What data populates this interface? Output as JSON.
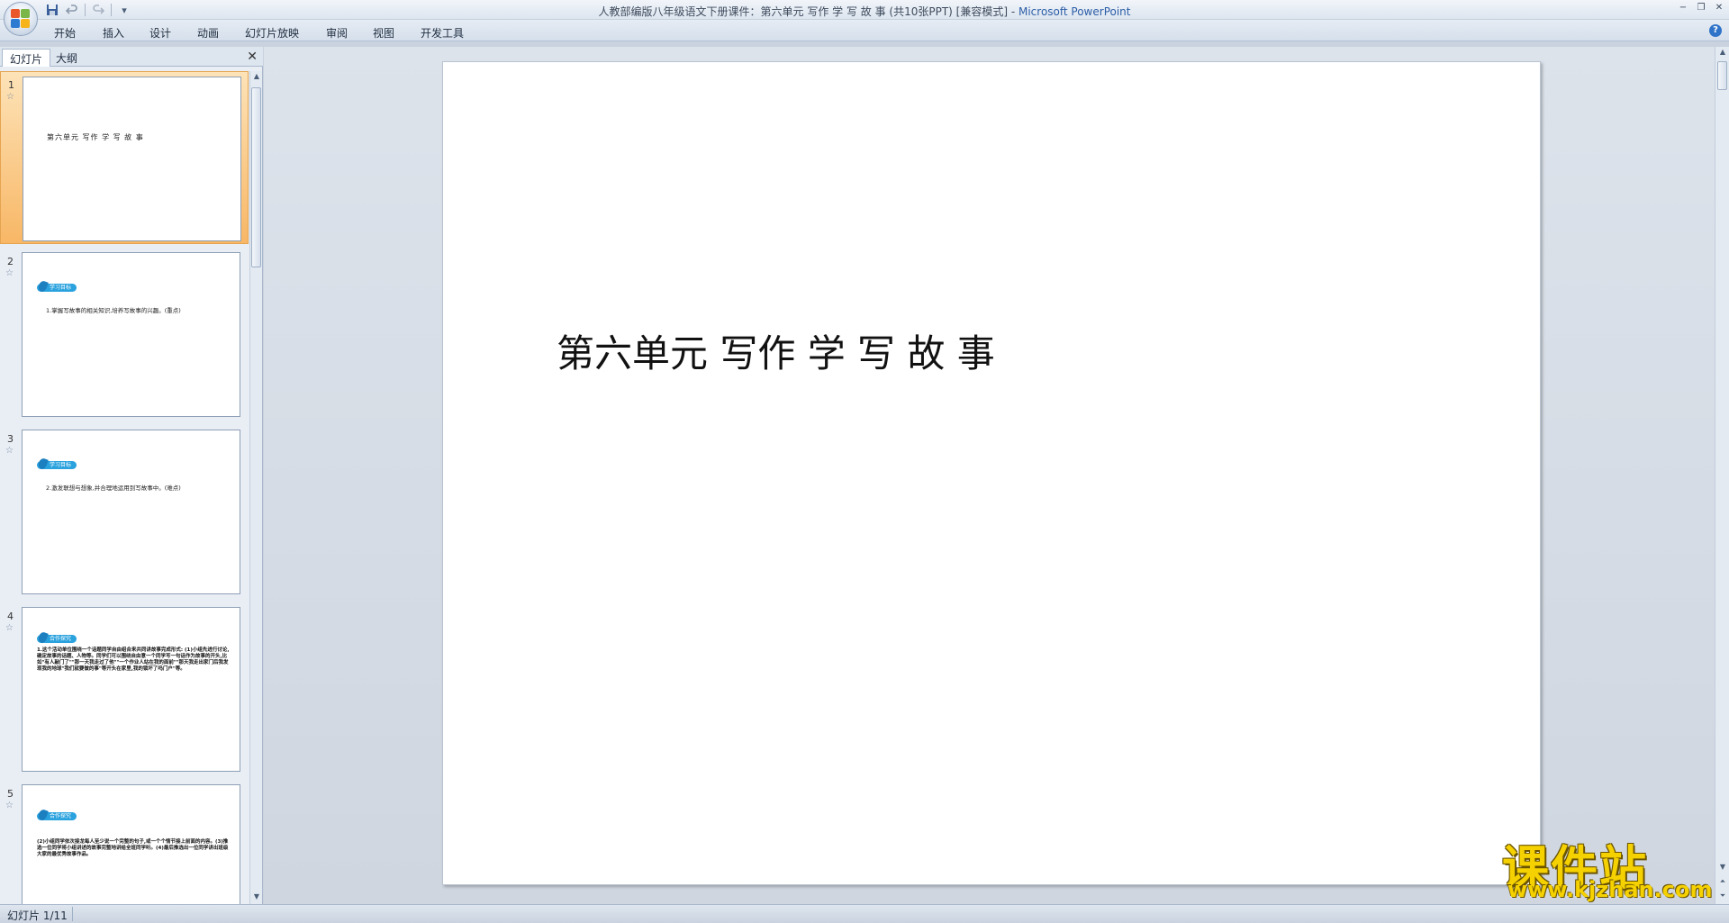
{
  "window": {
    "title_doc": "人教部编版八年级语文下册课件：第六单元 写作 学 写 故 事 (共10张PPT) [兼容模式] - ",
    "title_app": "Microsoft PowerPoint",
    "minimize": "−",
    "restore": "❐",
    "close": "✕"
  },
  "qat": {
    "save_icon": "save-icon",
    "undo_icon": "undo-icon",
    "redo_icon": "redo-icon",
    "customize": "▾"
  },
  "ribbon": {
    "tabs": [
      "开始",
      "插入",
      "设计",
      "动画",
      "幻灯片放映",
      "审阅",
      "视图",
      "开发工具"
    ],
    "help": "?"
  },
  "left_pane": {
    "tabs": [
      "幻灯片",
      "大纲"
    ],
    "close": "✕",
    "thumbnails": [
      {
        "number": "1",
        "title": "第六单元 写作 学 写 故 事"
      },
      {
        "number": "2",
        "badge": "学习目标",
        "text": "1.掌握写故事的相关知识,培养写故事的兴趣。(重点)"
      },
      {
        "number": "3",
        "badge": "学习目标",
        "text": "2.激发联想与想象,并合理地运用到写故事中。(难点)"
      },
      {
        "number": "4",
        "badge": "合作探究",
        "text": "1.这个活动单位围绕一个话题同学自由组合来共同讲故事完成形式: (1)小组先进行讨论,确定故事的话题、人物等。同学们可以围绕自由意一个同学写一句话作为故事的开头,比如\"有人敲门了\"\"那一天我走过了他\"\"一个作业人站在我的面前\"\"那天我走出家门后我发现我的地球\"我们就要做的事\"等开头在家里,我的锁坏了吗门户\"等。"
      },
      {
        "number": "5",
        "badge": "合作探究",
        "text": "(2)小组同学依次接龙每人至少说一个完整的句子,或一个个情节接上前面的内容。(3)推选一位同学将小组讲述的故事完整地讲给全班同学听。(4)最后推选出一位同学讲出班级大家的最优秀故事作品。"
      }
    ]
  },
  "slide": {
    "title": "第六单元 写作 学 写 故 事"
  },
  "watermark": {
    "name": "课件站",
    "url": "www.kjzhan.com"
  },
  "status": {
    "slide_info": "幻灯片 1/11"
  }
}
